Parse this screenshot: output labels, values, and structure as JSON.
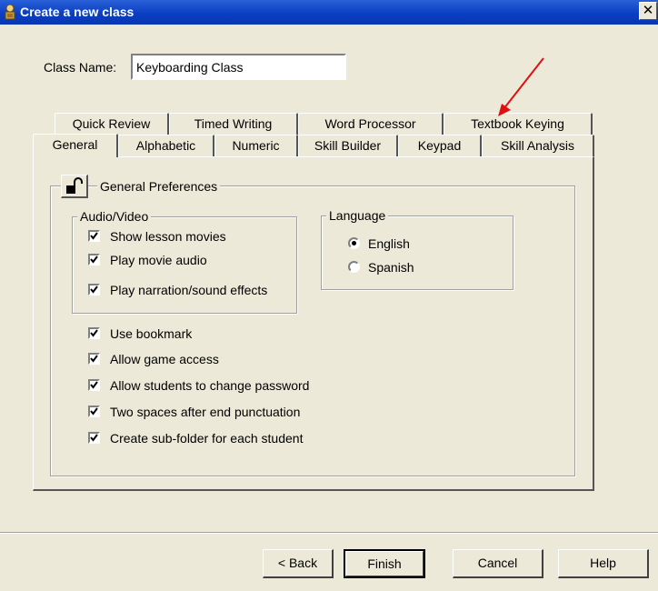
{
  "window": {
    "title": "Create a new class"
  },
  "class_name": {
    "label": "Class Name:",
    "value": "Keyboarding Class"
  },
  "tabs_back": [
    "Quick Review",
    "Timed Writing",
    "Word Processor",
    "Textbook Keying"
  ],
  "tabs_front": [
    "General",
    "Alphabetic",
    "Numeric",
    "Skill Builder",
    "Keypad",
    "Skill Analysis"
  ],
  "active_tab": "General",
  "general": {
    "group_title": "General Preferences",
    "audio_video": {
      "title": "Audio/Video",
      "items": [
        "Show lesson movies",
        "Play movie audio",
        "Play narration/sound effects"
      ]
    },
    "language": {
      "title": "Language",
      "options": [
        "English",
        "Spanish"
      ],
      "selected": "English"
    },
    "options": [
      "Use bookmark",
      "Allow game access",
      "Allow students to change password",
      "Two spaces after end punctuation",
      "Create sub-folder for each student"
    ]
  },
  "buttons": {
    "back": "< Back",
    "finish": "Finish",
    "cancel": "Cancel",
    "help": "Help"
  },
  "colors": {
    "titlebar": "#0a3fc2",
    "background": "#ece9d8",
    "annotation_arrow": "#e01010"
  },
  "icons": {
    "app": "app-icon",
    "lock": "unlock-icon",
    "close": "close-icon"
  }
}
